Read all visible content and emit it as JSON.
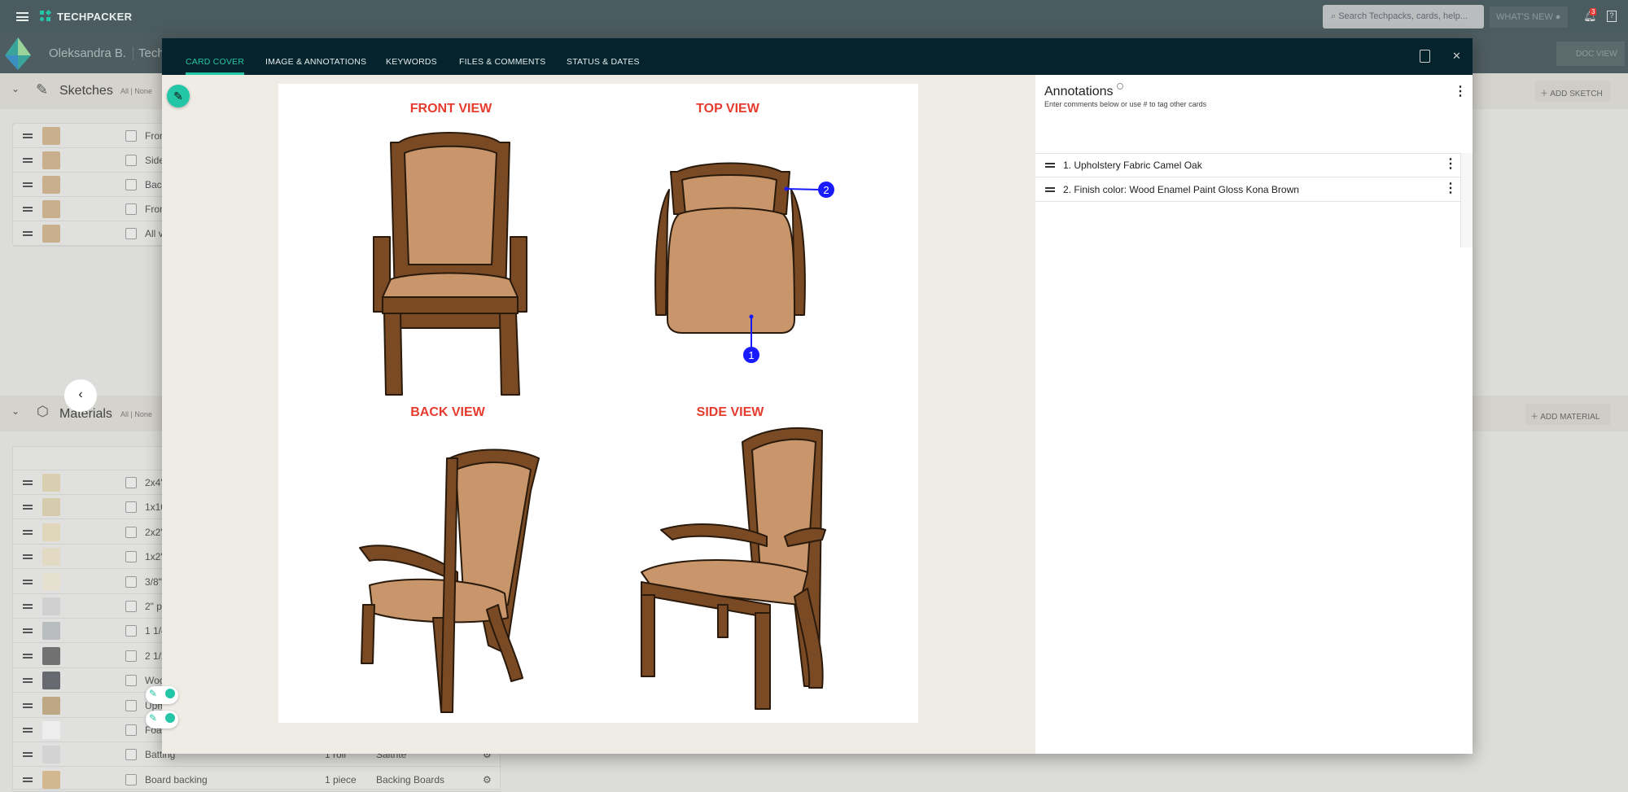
{
  "app": {
    "brand": "TECHPACKER",
    "search_placeholder": "Search Techpacks, cards, help...",
    "whats_new": "WHAT'S NEW",
    "notification_count": "3"
  },
  "subbar": {
    "user": "Oleksandra B.",
    "project_fragment": "Tech",
    "doc_view": "DOC VIEW"
  },
  "sketches": {
    "title": "Sketches",
    "all": "All",
    "none": "None",
    "add": "ADD SKETCH",
    "rows": [
      "Fron",
      "Side",
      "Bac",
      "Fron",
      "All v"
    ]
  },
  "materials": {
    "title": "Materials",
    "all": "All",
    "none": "None",
    "add": "ADD MATERIAL",
    "rows": [
      {
        "name": "2x4\""
      },
      {
        "name": "1x10"
      },
      {
        "name": "2x2\""
      },
      {
        "name": "1x2\""
      },
      {
        "name": "3/8\""
      },
      {
        "name": "2\" p"
      },
      {
        "name": "1 1/4"
      },
      {
        "name": "2 1/2"
      },
      {
        "name": "Woo"
      },
      {
        "name": "Uph"
      },
      {
        "name": "Foa"
      },
      {
        "name": "Batting",
        "qty": "1 roll",
        "supplier": "Saitrite"
      },
      {
        "name": "Board backing",
        "qty": "1 piece",
        "supplier": "Backing Boards"
      }
    ]
  },
  "modal": {
    "tabs": [
      "CARD COVER",
      "IMAGE & ANNOTATIONS",
      "KEYWORDS",
      "FILES & COMMENTS",
      "STATUS & DATES"
    ],
    "active_tab": "CARD COVER",
    "image": {
      "labels": [
        "FRONT VIEW",
        "TOP VIEW",
        "BACK VIEW",
        "SIDE VIEW"
      ],
      "markers": [
        "1",
        "2"
      ]
    },
    "annotations": {
      "title": "Annotations",
      "subtitle": "Enter comments below or use # to tag other cards",
      "items": [
        "1.  Upholstery Fabric Camel Oak",
        "2.  Finish color: Wood Enamel Paint Gloss Kona Brown"
      ]
    }
  },
  "colors": {
    "accent": "#23c6a6",
    "modal_header": "#04232d",
    "marker": "#1a1aff",
    "label_red": "#e63b2e"
  }
}
